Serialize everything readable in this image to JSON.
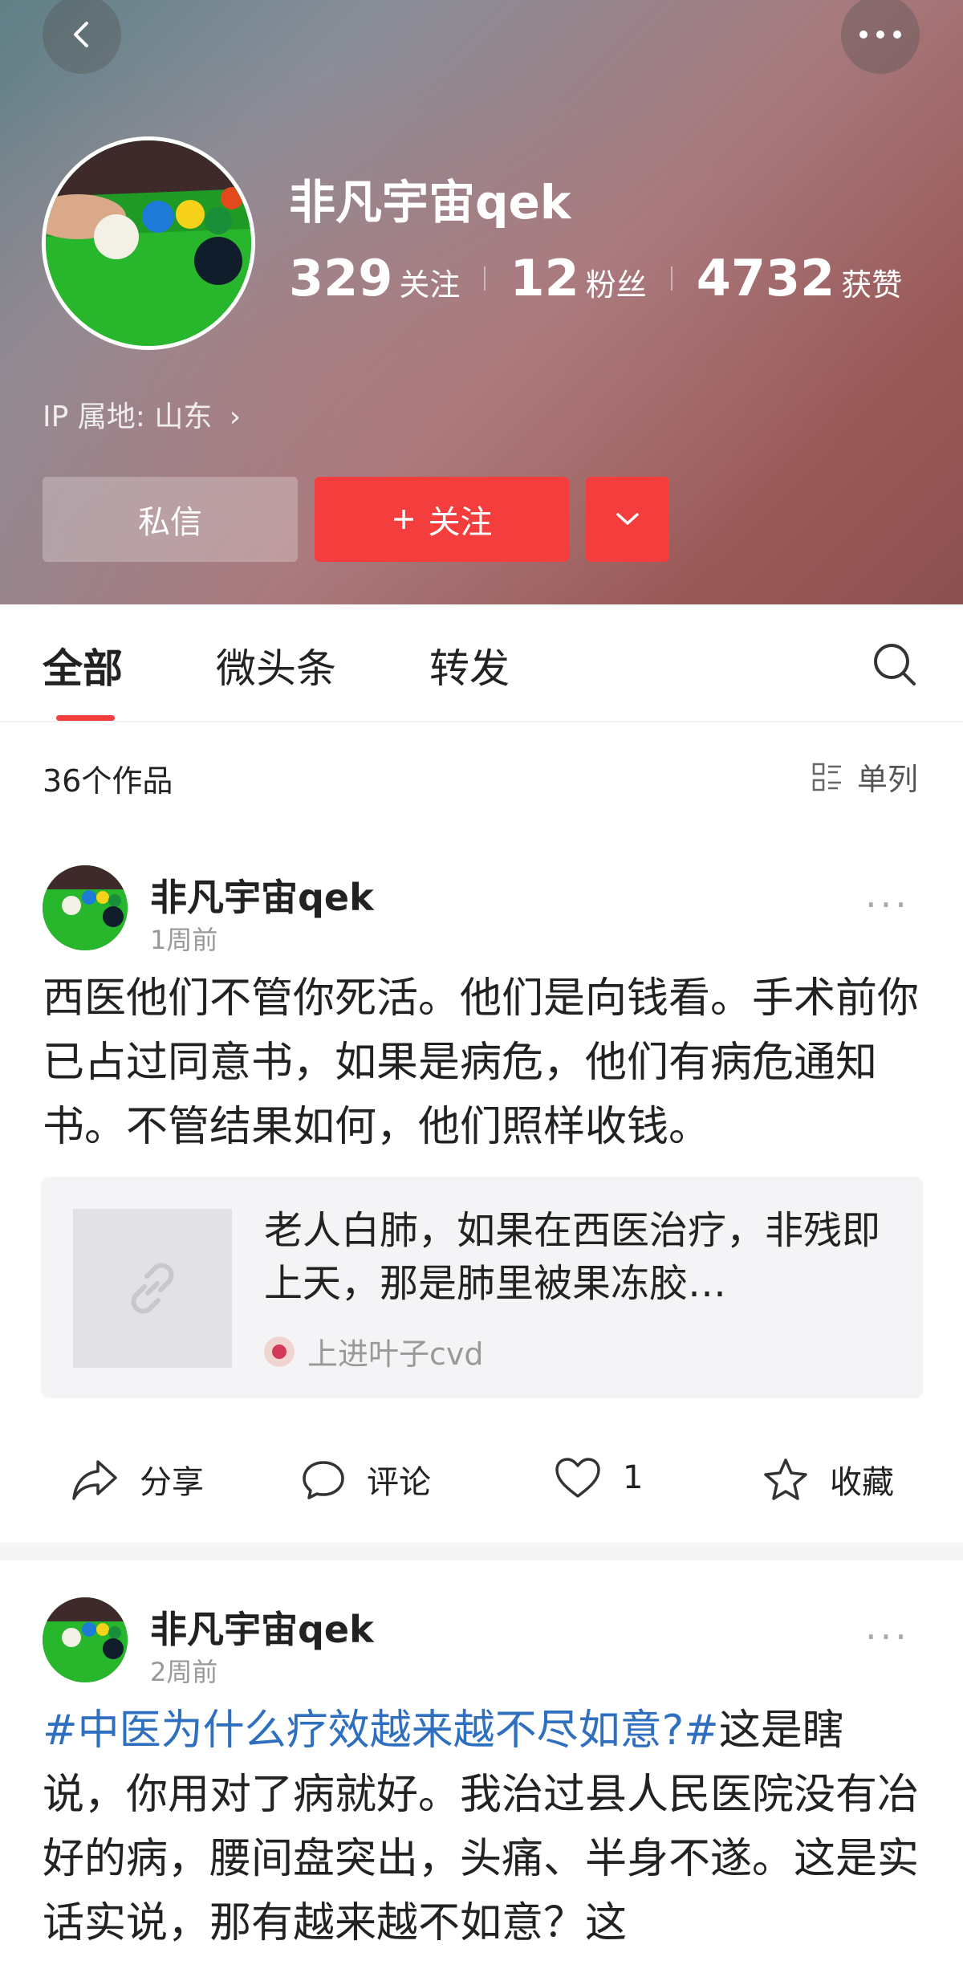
{
  "header": {
    "username": "非凡宇宙qek",
    "stats": [
      {
        "num": "329",
        "label": "关注"
      },
      {
        "num": "12",
        "label": "粉丝"
      },
      {
        "num": "4732",
        "label": "获赞"
      }
    ],
    "ip": "IP 属地: 山东",
    "message_label": "私信",
    "follow_label": "关注",
    "accent": "#f43e3e",
    "icons": {
      "back": "back-arrow-icon",
      "more": "more-dots-icon",
      "follow_plus": "plus-icon",
      "dropdown": "chevron-down-icon"
    }
  },
  "tabs": [
    {
      "label": "全部",
      "active": true
    },
    {
      "label": "微头条",
      "active": false
    },
    {
      "label": "转发",
      "active": false
    }
  ],
  "list": {
    "count": "36个作品",
    "view_mode": "单列"
  },
  "posts": [
    {
      "author": "非凡宇宙qek",
      "time": "1周前",
      "text": "西医他们不管你死活。他们是向钱看。手术前你已占过同意书，如果是病危，他们有病危通知书。不管结果如何，他们照样收钱。",
      "link": {
        "title": "老人白肺，如果在西医治疗，非残即上天，那是肺里被果冻胶…",
        "source": "上进叶子cvd"
      },
      "actions": {
        "share": "分享",
        "comment": "评论",
        "like": "1",
        "collect": "收藏"
      }
    },
    {
      "author": "非凡宇宙qek",
      "time": "2周前",
      "topic": "#中医为什么疗效越来越不尽如意?#",
      "text": "这是瞎说，你用对了病就好。我治过县人民医院没有冶好的病，腰间盘突出，头痛、半身不遂。这是实话实说，那有越来越不如意？这"
    }
  ]
}
